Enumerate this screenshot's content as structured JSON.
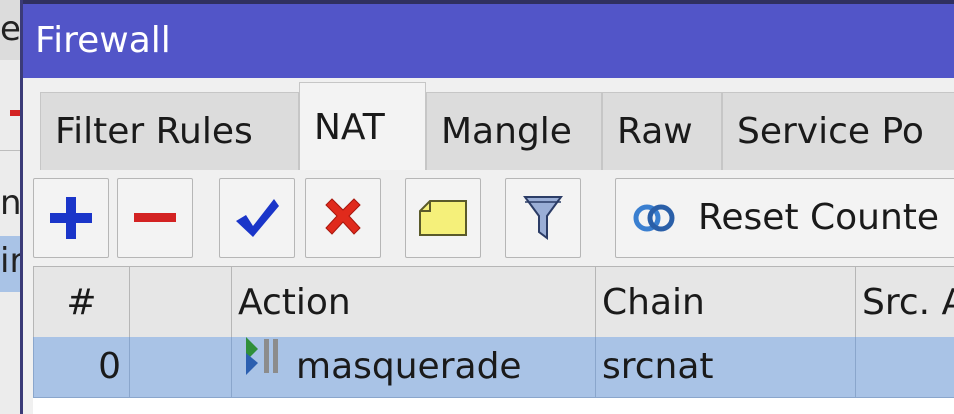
{
  "window": {
    "title": "Firewall"
  },
  "background": {
    "text_top": "e",
    "text_mid": "nt",
    "text_sel": "ir"
  },
  "tabs": [
    {
      "label": "Filter Rules",
      "active": false
    },
    {
      "label": "NAT",
      "active": true
    },
    {
      "label": "Mangle",
      "active": false
    },
    {
      "label": "Raw",
      "active": false
    },
    {
      "label": "Service Po",
      "active": false
    }
  ],
  "toolbar": {
    "add_icon": "plus-icon",
    "remove_icon": "minus-icon",
    "enable_icon": "checkmark-icon",
    "disable_icon": "x-icon",
    "comment_icon": "note-icon",
    "filter_icon": "funnel-icon",
    "reset_counters_label": "Reset Counte"
  },
  "table": {
    "columns": [
      "#",
      "",
      "Action",
      "Chain",
      "Src. A"
    ],
    "rows": [
      {
        "num": "0",
        "flags": "",
        "action": "masquerade",
        "chain": "srcnat",
        "src": ""
      }
    ]
  },
  "colors": {
    "titlebar": "#5255c8",
    "selected_row": "#a9c3e6",
    "add_blue": "#1a35c9",
    "remove_red": "#d32222",
    "check_blue": "#1a35c9",
    "x_red": "#e02a1c",
    "note_yellow": "#f5f07a"
  }
}
